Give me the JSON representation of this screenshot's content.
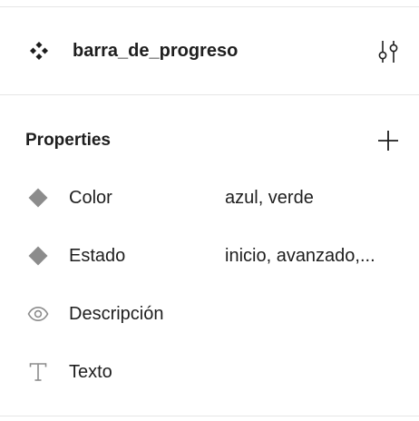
{
  "component": {
    "name": "barra_de_progreso",
    "icon": "component-icon"
  },
  "settings": {
    "icon": "adjust-icon"
  },
  "properties": {
    "title": "Properties",
    "add_icon": "plus-icon",
    "items": [
      {
        "icon": "variant-diamond-icon",
        "name": "Color",
        "value": "azul, verde"
      },
      {
        "icon": "variant-diamond-icon",
        "name": "Estado",
        "value": "inicio, avanzado,..."
      },
      {
        "icon": "eye-icon",
        "name": "Descripción",
        "value": ""
      },
      {
        "icon": "text-icon",
        "name": "Texto",
        "value": ""
      }
    ]
  },
  "colors": {
    "text": "#1e1e1e",
    "icon_muted": "#8c8c8c",
    "divider": "#e6e6e6"
  }
}
